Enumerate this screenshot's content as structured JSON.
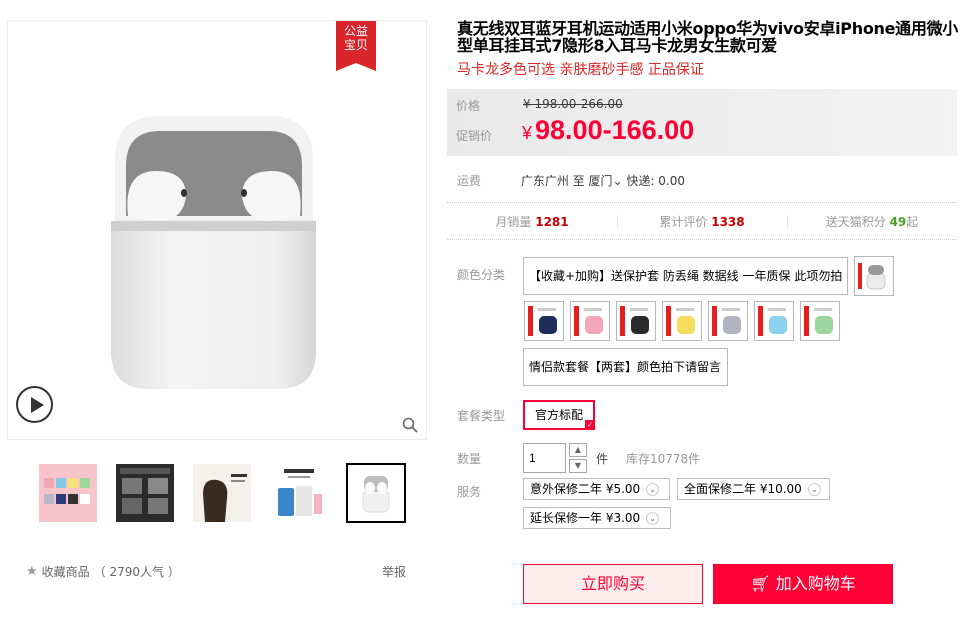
{
  "badge": {
    "line1": "公益",
    "line2": "宝贝"
  },
  "product": {
    "title": "真无线双耳蓝牙耳机运动适用小米oppo华为vivo安卓iPhone通用微小型单耳挂耳式7隐形8入耳马卡龙男女生款可爱",
    "subtitle": "马卡龙多色可选 亲肤磨砂手感 正品保证"
  },
  "price": {
    "label_original": "价格",
    "original": "¥ 198.00-266.00",
    "label_promo": "促销价",
    "currency": "¥",
    "promo": "98.00-166.00"
  },
  "shipping": {
    "label": "运费",
    "origin": "广东广州",
    "to": "至",
    "dest": "厦门",
    "fee": "快递: 0.00"
  },
  "stats": {
    "monthly_label": "月销量",
    "monthly": "1281",
    "reviews_label": "累计评价",
    "reviews": "1338",
    "points_label": "送天猫积分",
    "points": "49",
    "points_suffix": "起"
  },
  "sku": {
    "color_label": "颜色分类",
    "option_gift": "【收藏+加购】送保护套 防丢绳 数据线 一年质保 此项勿拍",
    "option_couple": "情侣款套餐【两套】颜色拍下请留言",
    "swatches": [
      "white",
      "navy",
      "pink",
      "black",
      "yellow",
      "gray",
      "sky-blue",
      "green"
    ],
    "package_label": "套餐类型",
    "package_selected": "官方标配"
  },
  "quantity": {
    "label": "数量",
    "value": "1",
    "unit": "件",
    "stock": "库存10778件"
  },
  "service": {
    "label": "服务",
    "options": [
      "意外保修二年 ¥5.00",
      "全面保修二年 ¥10.00",
      "延长保修一年 ¥3.00"
    ]
  },
  "actions": {
    "buy": "立即购买",
    "cart": "加入购物车"
  },
  "footer": {
    "favorite": "收藏商品",
    "popularity": "（ 2790人气 ）",
    "report": "举报"
  },
  "colors": {
    "accent": "#ff0036",
    "tmall_red": "#dd2727",
    "green": "#4a9e27"
  }
}
